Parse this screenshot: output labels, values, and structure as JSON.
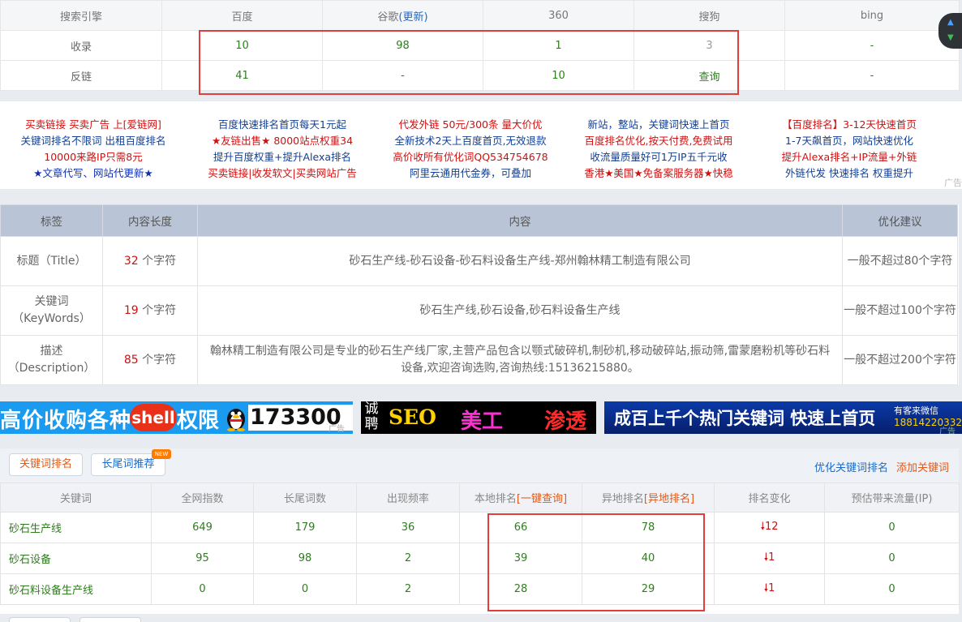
{
  "engine_table": {
    "headers": [
      "搜索引擎",
      "百度",
      "谷歌",
      "360",
      "搜狗",
      "bing"
    ],
    "google_update": "(更新)",
    "rows": [
      {
        "label": "收录",
        "values": [
          "10",
          "98",
          "1",
          "3",
          "-"
        ]
      },
      {
        "label": "反链",
        "values": [
          "41",
          "-",
          "10",
          "查询",
          "-"
        ]
      }
    ]
  },
  "text_ads": {
    "columns": [
      [
        "买卖链接 买卖广告 上[爱链网]",
        "关键词排名不限词 出租百度排名",
        "10000来路IP只需8元",
        "★文章代写、网站代更新★"
      ],
      [
        "百度快速排名首页每天1元起",
        "★友链出售★ 8000站点权重34",
        "提升百度权重+提升Alexa排名",
        "买卖链接|收发软文|买卖网站广告"
      ],
      [
        "代发外链 50元/300条 量大价优",
        "全新技术2天上百度首页,无效退款",
        "高价收所有优化词QQ534754678",
        "阿里云通用代金券，可叠加"
      ],
      [
        "新站，整站，关键词快速上首页",
        "百度排名优化,按天付费,免费试用",
        "收流量质量好可1万IP五千元收",
        "香港★美国★免备案服务器★快稳"
      ],
      [
        "【百度排名】3-12天快速首页",
        "1-7天飙首页，网站快速优化",
        "提升Alexa排名+IP流量+外链",
        "外链代发 快速排名 权重提升"
      ]
    ],
    "tag": "广告"
  },
  "meta_table": {
    "headers": [
      "标签",
      "内容长度",
      "内容",
      "优化建议"
    ],
    "rows": [
      {
        "tag": [
          "标题（Title）"
        ],
        "length": "32",
        "unit": "个字符",
        "content": "砂石生产线-砂石设备-砂石料设备生产线-郑州翰林精工制造有限公司",
        "advice": "一般不超过80个字符"
      },
      {
        "tag": [
          "关键词",
          "（KeyWords）"
        ],
        "length": "19",
        "unit": "个字符",
        "content": "砂石生产线,砂石设备,砂石料设备生产线",
        "advice": "一般不超过100个字符"
      },
      {
        "tag": [
          "描述",
          "（Description）"
        ],
        "length": "85",
        "unit": "个字符",
        "content": "翰林精工制造有限公司是专业的砂石生产线厂家,主营产品包含以颚式破碎机,制砂机,移动破碎站,振动筛,雷蒙磨粉机等砂石料设备,欢迎咨询选购,咨询热线:15136215880。",
        "advice": "一般不超过200个字符"
      }
    ]
  },
  "banners": {
    "b1_text1": "高价收购各种",
    "b1_shell": "shell",
    "b1_text2": "权限",
    "b1_number": "173300",
    "b1_tag": "广告",
    "b2_recruit": "诚聘",
    "b2_seo": "SEO",
    "b2_design": "美工",
    "b2_pentest": "渗透",
    "b3_text": "成百上千个热门关键词 快速上首页",
    "b3_wechat": "有客来微信",
    "b3_phone": "18814220332",
    "b3_tag": "广告"
  },
  "keyword_section": {
    "tab_ranking": "关键词排名",
    "tab_longtail": "长尾词推荐",
    "new_badge": "NEW",
    "link_optimize": "优化关键词排名",
    "link_add": "添加关键词",
    "headers": [
      "关键词",
      "全网指数",
      "长尾词数",
      "出现频率",
      "本地排名",
      "异地排名",
      "排名变化",
      "预估带来流量(IP)"
    ],
    "local_query": "[一键查询]",
    "remote_query": "[异地排名]",
    "rows": [
      {
        "keyword": "砂石生产线",
        "index": "649",
        "longtail": "179",
        "freq": "36",
        "local": "66",
        "remote": "78",
        "change": "12",
        "traffic": "0"
      },
      {
        "keyword": "砂石设备",
        "index": "95",
        "longtail": "98",
        "freq": "2",
        "local": "39",
        "remote": "40",
        "change": "1",
        "traffic": "0"
      },
      {
        "keyword": "砂石料设备生产线",
        "index": "0",
        "longtail": "0",
        "freq": "2",
        "local": "28",
        "remote": "29",
        "change": "1",
        "traffic": "0"
      }
    ]
  },
  "colors": {
    "green_value": "#2e7d1e",
    "red_accent": "#d01010",
    "highlight_box": "#e03d3d",
    "header_blue_grey": "#b9c4d6"
  }
}
